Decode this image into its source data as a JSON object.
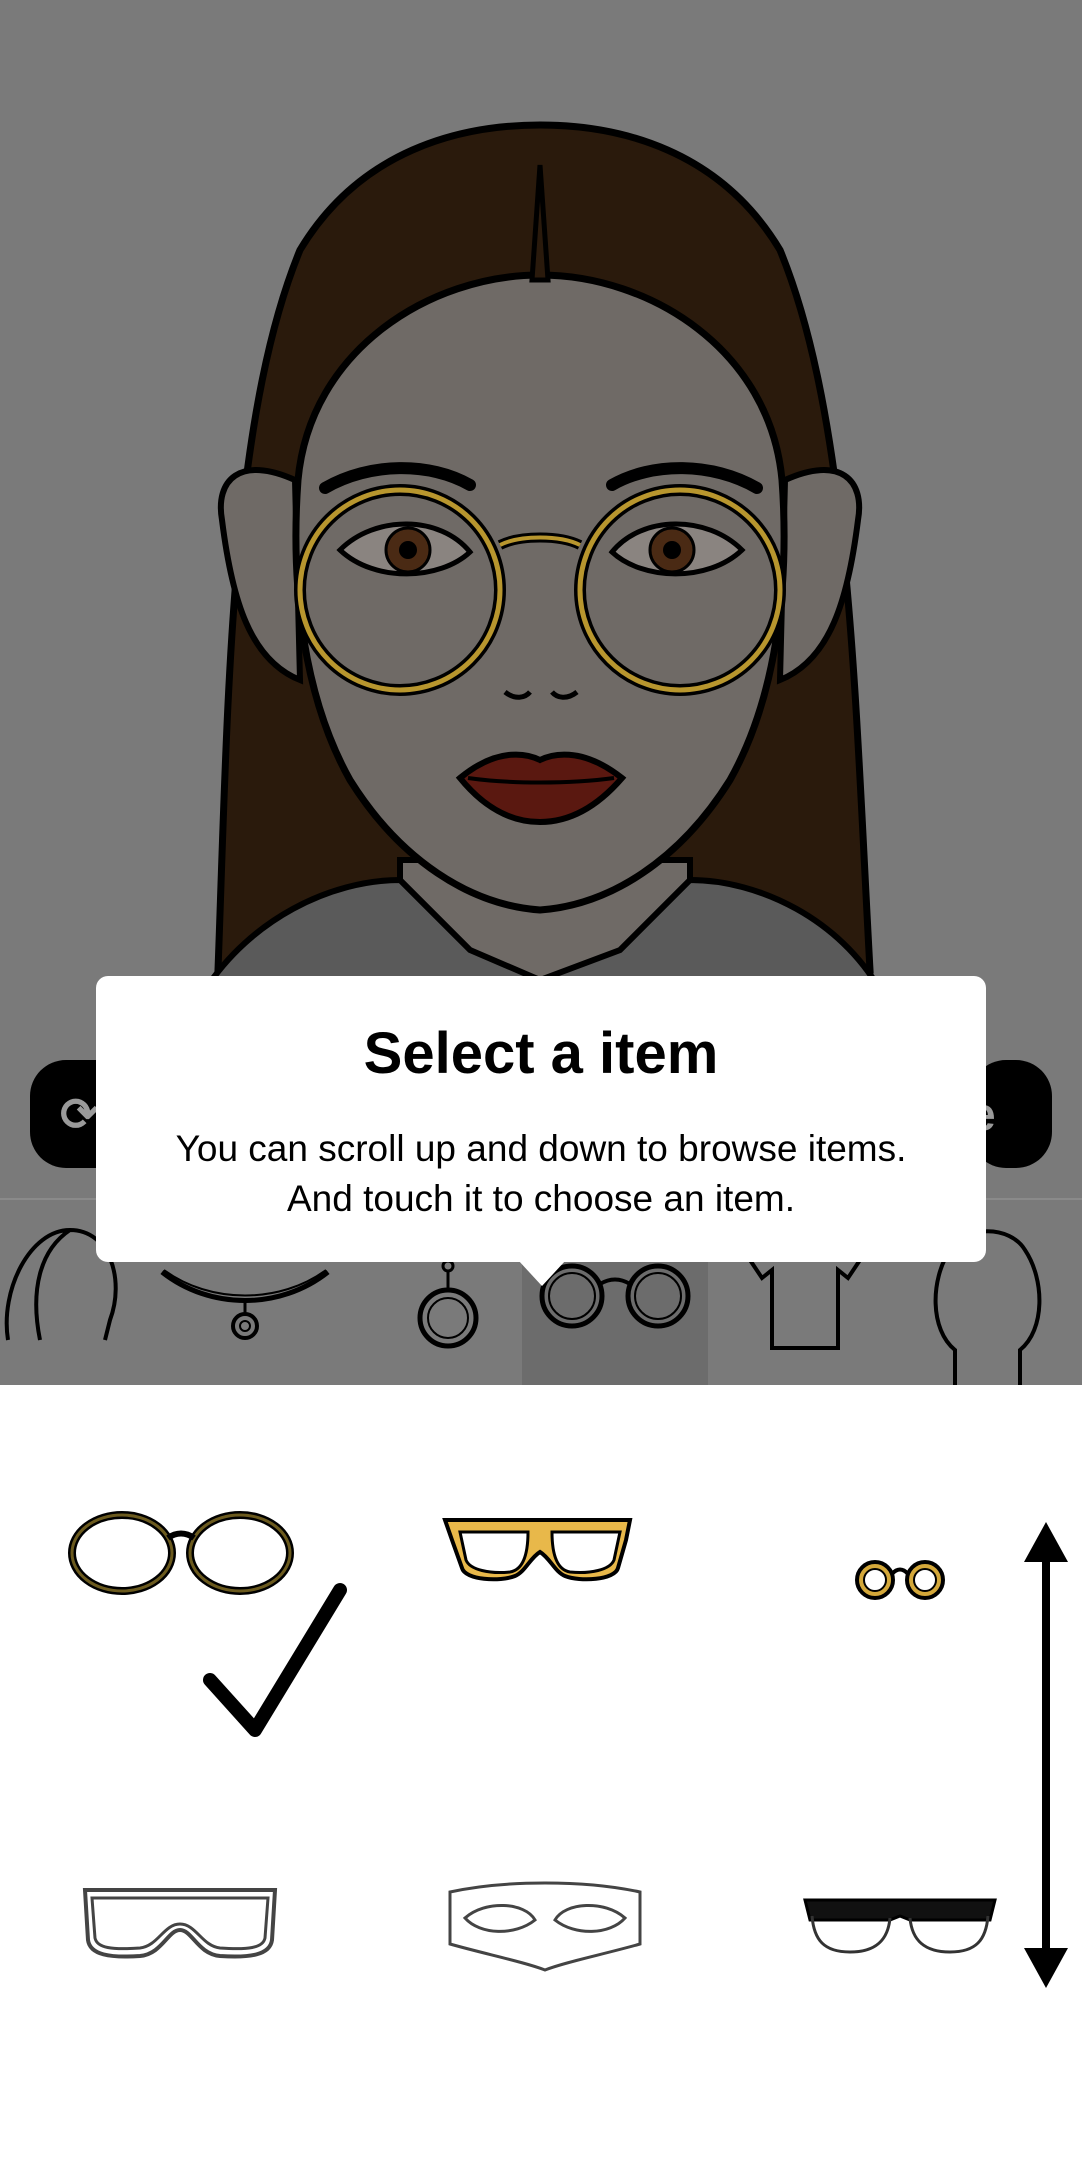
{
  "tooltip": {
    "title": "Select a item",
    "line1": "You can scroll up and down to browse items.",
    "line2": "And touch it to choose an item."
  },
  "buttons": {
    "left_partial_glyph": "⟳",
    "right_partial_label": "e"
  },
  "categories": [
    {
      "name": "hair",
      "icon": "hair-icon",
      "selected": false
    },
    {
      "name": "necklace",
      "icon": "necklace-icon",
      "selected": false
    },
    {
      "name": "earring",
      "icon": "earring-icon",
      "selected": false
    },
    {
      "name": "glasses",
      "icon": "glasses-icon",
      "selected": true
    },
    {
      "name": "shirt",
      "icon": "shirt-icon",
      "selected": false
    },
    {
      "name": "head",
      "icon": "head-icon",
      "selected": false
    }
  ],
  "items": [
    {
      "name": "round-glasses",
      "color": "#6b5a1e",
      "selected": true
    },
    {
      "name": "yellow-square-glasses",
      "color": "#e8b84a",
      "selected": false
    },
    {
      "name": "small-round-glasses",
      "color": "#d4a83a",
      "selected": false
    },
    {
      "name": "goggles",
      "color": "#444444",
      "selected": false
    },
    {
      "name": "mask-glasses",
      "color": "#444444",
      "selected": false
    },
    {
      "name": "browline-glasses",
      "color": "#111111",
      "selected": false
    }
  ],
  "colors": {
    "background_dim": "#7a7a7a",
    "hair": "#2a1a0c",
    "skin": "#6f6a66",
    "lips": "#5a1810",
    "frame_gold": "#b8962e"
  }
}
